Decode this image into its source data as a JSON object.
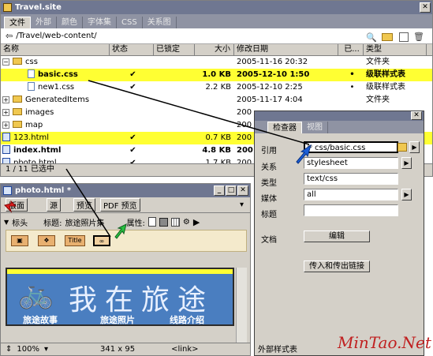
{
  "site_window": {
    "title": "Travel.site",
    "tabs": [
      "文件",
      "外部",
      "颜色",
      "字体集",
      "CSS",
      "关系图"
    ],
    "path": "/Travel/web-content/",
    "columns": [
      "名称",
      "状态",
      "已锁定",
      "大小",
      "修改日期",
      "已...",
      "类型"
    ],
    "rows": [
      {
        "name": "css",
        "status": "",
        "size": "",
        "date": "2005-11-16 20:32",
        "chk": "",
        "type": "文件夹",
        "kind": "folder-open",
        "hl": false,
        "bold": false
      },
      {
        "name": "basic.css",
        "status": "✔",
        "size": "1.0 KB",
        "date": "2005-12-10 1:50",
        "chk": "•",
        "type": "级联样式表",
        "kind": "file",
        "hl": true,
        "bold": true
      },
      {
        "name": "new1.css",
        "status": "✔",
        "size": "2.2 KB",
        "date": "2005-12-10 2:25",
        "chk": "•",
        "type": "级联样式表",
        "kind": "file",
        "hl": false,
        "bold": false
      },
      {
        "name": "GeneratedItems",
        "status": "",
        "size": "",
        "date": "2005-11-17 4:04",
        "chk": "",
        "type": "文件夹",
        "kind": "folder",
        "hl": false,
        "bold": false
      },
      {
        "name": "images",
        "status": "",
        "size": "",
        "date": "200",
        "chk": "",
        "type": "",
        "kind": "folder",
        "hl": false,
        "bold": false
      },
      {
        "name": "map",
        "status": "",
        "size": "",
        "date": "200",
        "chk": "",
        "type": "",
        "kind": "folder",
        "hl": false,
        "bold": false
      },
      {
        "name": "123.html",
        "status": "✔",
        "size": "0.7 KB",
        "date": "200",
        "chk": "",
        "type": "",
        "kind": "html",
        "hl": true,
        "bold": false
      },
      {
        "name": "index.html",
        "status": "✔",
        "size": "4.8 KB",
        "date": "200",
        "chk": "",
        "type": "",
        "kind": "html",
        "hl": false,
        "bold": true
      },
      {
        "name": "photo.html",
        "status": "✔",
        "size": "1.7 KB",
        "date": "200",
        "chk": "",
        "type": "",
        "kind": "html",
        "hl": false,
        "bold": false
      }
    ],
    "status_text": "1 / 11 已选中"
  },
  "doc_window": {
    "title": "photo.html *",
    "toolbar": [
      "版面",
      "源",
      "预览",
      "PDF 预览"
    ],
    "head_label": "标头",
    "page_title_label": "标题:",
    "page_title_value": "旅途照片集",
    "attr_label": "属性:",
    "tag_title": "Title",
    "banner_text": "我在旅途",
    "banner_links": [
      "旅途故事",
      "旅途照片",
      "线路介绍"
    ],
    "status_zoom": "100%",
    "status_size": "341 x 95",
    "status_tag": "<link>"
  },
  "inspector": {
    "tabs": [
      "检查器",
      "视图"
    ],
    "labels": {
      "href": "引用",
      "rel": "关系",
      "type": "类型",
      "media": "媒体",
      "title": "标题",
      "doc": "文档"
    },
    "values": {
      "href": "css/basic.css",
      "rel": "stylesheet",
      "type": "text/css",
      "media": "all",
      "title": ""
    },
    "edit_button": "编辑",
    "links_button": "传入和传出链接",
    "footer": "外部样式表"
  },
  "watermark": "MinTao.Net",
  "colors": {
    "highlight": "#ffff33",
    "titlebar": "#6f7791",
    "banner": "#5a8ac8"
  }
}
